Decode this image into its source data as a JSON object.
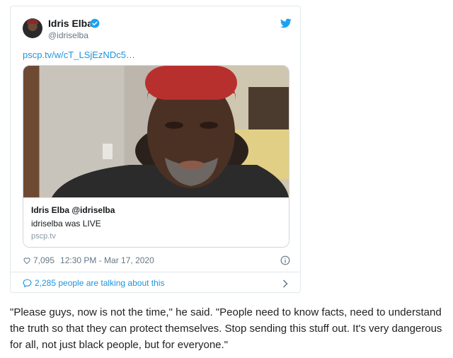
{
  "tweet": {
    "author_name": "Idris Elba",
    "author_handle": "@idriselba",
    "link_text": "pscp.tv/w/cT_LSjEzNDc5…",
    "card": {
      "title": "Idris Elba @idriselba",
      "description": "idriselba was LIVE",
      "domain": "pscp.tv"
    },
    "likes": "7,095",
    "timestamp": "12:30 PM - Mar 17, 2020",
    "talking": "2,285 people are talking about this"
  },
  "article": {
    "quote": "\"Please guys, now is not the time,\" he said. \"People need to know facts, need to understand the truth so that they can protect themselves. Stop sending this stuff out. It's very dangerous for all, not just black people, but for everyone.\""
  },
  "colors": {
    "link": "#1b95e0",
    "muted": "#657786",
    "border": "#e1e8ed"
  }
}
